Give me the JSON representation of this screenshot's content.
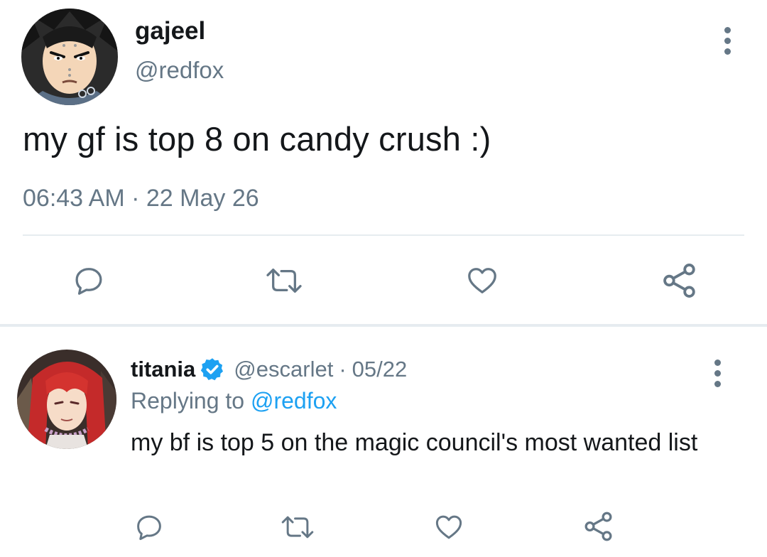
{
  "main_tweet": {
    "display_name": "gajeel",
    "handle": "@redfox",
    "text": "my gf is top 8 on candy crush :)",
    "time": "06:43 AM",
    "separator": "·",
    "date": "22 May 26",
    "actions": [
      "reply-icon",
      "retweet-icon",
      "like-icon",
      "share-icon"
    ]
  },
  "reply_tweet": {
    "display_name": "titania",
    "verified": true,
    "handle": "@escarlet",
    "separator": "·",
    "date": "05/22",
    "replying_prefix": "Replying to",
    "replying_to": "@redfox",
    "text": "my bf is top 5 on the magic council's most wanted list",
    "actions": [
      "reply-icon",
      "retweet-icon",
      "like-icon",
      "share-icon"
    ]
  },
  "colors": {
    "text_primary": "#14171a",
    "text_secondary": "#657786",
    "link": "#1da1f2",
    "divider": "#e6ecf0",
    "verified_badge": "#1da1f2"
  }
}
